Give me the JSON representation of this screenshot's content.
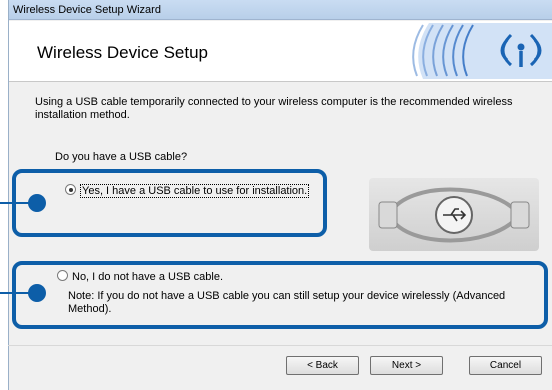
{
  "window": {
    "title": "Wireless Device Setup Wizard"
  },
  "header": {
    "title": "Wireless Device Setup",
    "logo_icon": "wireless-signal-icon"
  },
  "intro": "Using a USB cable temporarily connected to your wireless computer is the recommended wireless installation method.",
  "question": "Do you have a USB cable?",
  "options": {
    "yes": {
      "label": "Yes, I have a USB cable to use for installation.",
      "selected": true
    },
    "no": {
      "label": "No, I do not have a USB cable.",
      "selected": false
    }
  },
  "note": "Note: If you do not have a USB cable you can still setup your device wirelessly (Advanced Method).",
  "buttons": {
    "back": "< Back",
    "next": "Next >",
    "cancel": "Cancel"
  },
  "colors": {
    "highlight": "#0d5ea8",
    "logo": "#1a64b4"
  }
}
